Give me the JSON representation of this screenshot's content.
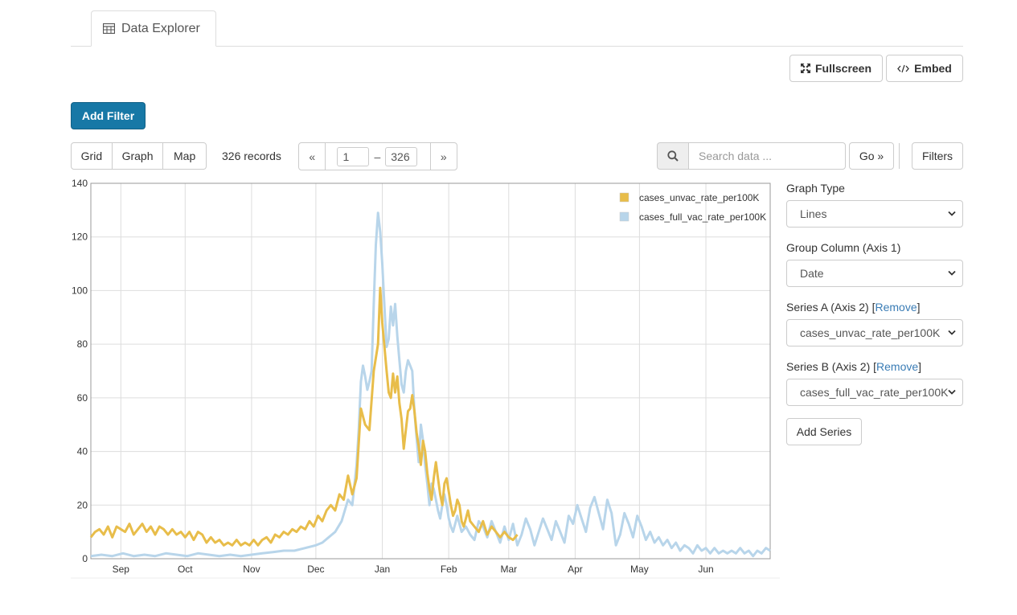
{
  "tab": {
    "label": "Data Explorer",
    "icon": "table-icon"
  },
  "toolbar": {
    "fullscreen_label": "Fullscreen",
    "embed_label": "Embed"
  },
  "filters": {
    "add_filter_label": "Add Filter",
    "filters_label": "Filters"
  },
  "view_switcher": {
    "grid": "Grid",
    "graph": "Graph",
    "map": "Map"
  },
  "records": {
    "count_label": "326 records"
  },
  "pager": {
    "prev": "«",
    "from": "1",
    "dash": "–",
    "to": "326",
    "next": "»"
  },
  "search": {
    "placeholder": "Search data ...",
    "go_label": "Go »"
  },
  "panel": {
    "graph_type_label": "Graph Type",
    "graph_type_value": "Lines",
    "group_column_label": "Group Column (Axis 1)",
    "group_column_value": "Date",
    "series_a_label": "Series A (Axis 2) [",
    "series_a_remove": "Remove",
    "series_a_close": "]",
    "series_a_value": "cases_unvac_rate_per100K",
    "series_b_label": "Series B (Axis 2) [",
    "series_b_remove": "Remove",
    "series_b_close": "]",
    "series_b_value": "cases_full_vac_rate_per100K",
    "add_series_label": "Add Series"
  },
  "chart_data": {
    "type": "line",
    "x_tick_labels": [
      "Sep",
      "Oct",
      "Nov",
      "Dec",
      "Jan",
      "Feb",
      "Mar",
      "Apr",
      "May",
      "Jun"
    ],
    "x_tick_day": [
      17,
      47,
      78,
      108,
      139,
      170,
      198,
      229,
      259,
      290
    ],
    "x_range_day": [
      3,
      320
    ],
    "ylim": [
      0,
      140
    ],
    "y_ticks": [
      0,
      20,
      40,
      60,
      80,
      100,
      120,
      140
    ],
    "grid": true,
    "legend_position": "top-right",
    "series": [
      {
        "name": "cases_unvac_rate_per100K",
        "color": "#e8bd4a",
        "points": [
          [
            3,
            8
          ],
          [
            5,
            10
          ],
          [
            7,
            11
          ],
          [
            9,
            9
          ],
          [
            11,
            12
          ],
          [
            13,
            8
          ],
          [
            15,
            12
          ],
          [
            17,
            11
          ],
          [
            19,
            10
          ],
          [
            21,
            13
          ],
          [
            23,
            9
          ],
          [
            25,
            11
          ],
          [
            27,
            13
          ],
          [
            29,
            10
          ],
          [
            31,
            12
          ],
          [
            33,
            9
          ],
          [
            35,
            12
          ],
          [
            37,
            11
          ],
          [
            39,
            9
          ],
          [
            41,
            11
          ],
          [
            43,
            9
          ],
          [
            45,
            10
          ],
          [
            47,
            8
          ],
          [
            49,
            10
          ],
          [
            51,
            7
          ],
          [
            53,
            10
          ],
          [
            55,
            9
          ],
          [
            57,
            6
          ],
          [
            59,
            8
          ],
          [
            61,
            6
          ],
          [
            63,
            7
          ],
          [
            65,
            5
          ],
          [
            67,
            6
          ],
          [
            69,
            5
          ],
          [
            71,
            7
          ],
          [
            73,
            5
          ],
          [
            75,
            6
          ],
          [
            77,
            5
          ],
          [
            79,
            7
          ],
          [
            81,
            5
          ],
          [
            83,
            7
          ],
          [
            85,
            8
          ],
          [
            87,
            6
          ],
          [
            89,
            9
          ],
          [
            91,
            8
          ],
          [
            93,
            10
          ],
          [
            95,
            9
          ],
          [
            97,
            11
          ],
          [
            99,
            10
          ],
          [
            101,
            12
          ],
          [
            103,
            11
          ],
          [
            105,
            14
          ],
          [
            107,
            12
          ],
          [
            109,
            16
          ],
          [
            111,
            14
          ],
          [
            113,
            18
          ],
          [
            115,
            20
          ],
          [
            117,
            18
          ],
          [
            119,
            24
          ],
          [
            121,
            22
          ],
          [
            123,
            31
          ],
          [
            125,
            24
          ],
          [
            127,
            30
          ],
          [
            129,
            56
          ],
          [
            131,
            50
          ],
          [
            133,
            48
          ],
          [
            135,
            70
          ],
          [
            137,
            80
          ],
          [
            138,
            101
          ],
          [
            139,
            88
          ],
          [
            141,
            70
          ],
          [
            142,
            62
          ],
          [
            143,
            60
          ],
          [
            144,
            69
          ],
          [
            145,
            62
          ],
          [
            146,
            68
          ],
          [
            147,
            58
          ],
          [
            148,
            52
          ],
          [
            149,
            41
          ],
          [
            150,
            48
          ],
          [
            151,
            55
          ],
          [
            152,
            56
          ],
          [
            153,
            61
          ],
          [
            154,
            55
          ],
          [
            155,
            47
          ],
          [
            156,
            42
          ],
          [
            157,
            35
          ],
          [
            158,
            44
          ],
          [
            159,
            40
          ],
          [
            160,
            32
          ],
          [
            161,
            26
          ],
          [
            162,
            22
          ],
          [
            163,
            30
          ],
          [
            164,
            36
          ],
          [
            165,
            30
          ],
          [
            166,
            24
          ],
          [
            167,
            20
          ],
          [
            168,
            28
          ],
          [
            169,
            30
          ],
          [
            170,
            25
          ],
          [
            171,
            20
          ],
          [
            172,
            16
          ],
          [
            173,
            18
          ],
          [
            174,
            22
          ],
          [
            175,
            20
          ],
          [
            176,
            14
          ],
          [
            177,
            12
          ],
          [
            178,
            15
          ],
          [
            179,
            18
          ],
          [
            180,
            14
          ],
          [
            182,
            12
          ],
          [
            184,
            10
          ],
          [
            186,
            14
          ],
          [
            188,
            9
          ],
          [
            190,
            12
          ],
          [
            192,
            10
          ],
          [
            194,
            8
          ],
          [
            196,
            10
          ],
          [
            198,
            8
          ],
          [
            200,
            7
          ],
          [
            202,
            9
          ]
        ]
      },
      {
        "name": "cases_full_vac_rate_per100K",
        "color": "#b8d5ea",
        "points": [
          [
            3,
            1
          ],
          [
            8,
            1.5
          ],
          [
            13,
            1
          ],
          [
            18,
            2
          ],
          [
            23,
            1
          ],
          [
            28,
            1.5
          ],
          [
            33,
            1
          ],
          [
            38,
            2
          ],
          [
            43,
            1.5
          ],
          [
            48,
            1
          ],
          [
            53,
            2
          ],
          [
            58,
            1.5
          ],
          [
            63,
            1
          ],
          [
            68,
            1.5
          ],
          [
            73,
            1
          ],
          [
            78,
            1.5
          ],
          [
            83,
            2
          ],
          [
            88,
            2.5
          ],
          [
            93,
            3
          ],
          [
            98,
            3
          ],
          [
            103,
            4
          ],
          [
            108,
            5
          ],
          [
            111,
            6
          ],
          [
            114,
            8
          ],
          [
            117,
            10
          ],
          [
            120,
            14
          ],
          [
            123,
            22
          ],
          [
            125,
            20
          ],
          [
            127,
            35
          ],
          [
            128,
            48
          ],
          [
            129,
            66
          ],
          [
            130,
            72
          ],
          [
            131,
            68
          ],
          [
            132,
            63
          ],
          [
            133,
            66
          ],
          [
            134,
            70
          ],
          [
            135,
            95
          ],
          [
            136,
            117
          ],
          [
            137,
            129
          ],
          [
            138,
            122
          ],
          [
            139,
            110
          ],
          [
            140,
            94
          ],
          [
            141,
            79
          ],
          [
            142,
            82
          ],
          [
            143,
            94
          ],
          [
            144,
            87
          ],
          [
            145,
            95
          ],
          [
            146,
            83
          ],
          [
            147,
            74
          ],
          [
            148,
            65
          ],
          [
            149,
            62
          ],
          [
            150,
            70
          ],
          [
            151,
            74
          ],
          [
            152,
            72
          ],
          [
            153,
            70
          ],
          [
            154,
            55
          ],
          [
            155,
            45
          ],
          [
            156,
            36
          ],
          [
            157,
            50
          ],
          [
            158,
            44
          ],
          [
            159,
            35
          ],
          [
            160,
            28
          ],
          [
            161,
            20
          ],
          [
            162,
            28
          ],
          [
            163,
            26
          ],
          [
            164,
            22
          ],
          [
            165,
            18
          ],
          [
            166,
            15
          ],
          [
            167,
            20
          ],
          [
            168,
            24
          ],
          [
            169,
            20
          ],
          [
            170,
            15
          ],
          [
            171,
            12
          ],
          [
            172,
            10
          ],
          [
            173,
            13
          ],
          [
            174,
            16
          ],
          [
            175,
            13
          ],
          [
            176,
            10
          ],
          [
            178,
            12
          ],
          [
            180,
            9
          ],
          [
            182,
            7
          ],
          [
            184,
            14
          ],
          [
            186,
            12
          ],
          [
            188,
            8
          ],
          [
            190,
            14
          ],
          [
            192,
            10
          ],
          [
            194,
            6
          ],
          [
            196,
            12
          ],
          [
            198,
            7
          ],
          [
            200,
            13
          ],
          [
            202,
            5
          ],
          [
            204,
            9
          ],
          [
            206,
            15
          ],
          [
            208,
            11
          ],
          [
            210,
            5
          ],
          [
            212,
            10
          ],
          [
            214,
            15
          ],
          [
            216,
            11
          ],
          [
            218,
            7
          ],
          [
            220,
            14
          ],
          [
            222,
            10
          ],
          [
            224,
            6
          ],
          [
            226,
            16
          ],
          [
            228,
            13
          ],
          [
            230,
            20
          ],
          [
            232,
            15
          ],
          [
            234,
            10
          ],
          [
            236,
            19
          ],
          [
            238,
            23
          ],
          [
            240,
            17
          ],
          [
            242,
            11
          ],
          [
            244,
            22
          ],
          [
            246,
            17
          ],
          [
            248,
            5
          ],
          [
            250,
            9
          ],
          [
            252,
            17
          ],
          [
            254,
            13
          ],
          [
            256,
            8
          ],
          [
            258,
            16
          ],
          [
            260,
            12
          ],
          [
            262,
            7
          ],
          [
            264,
            10
          ],
          [
            266,
            6
          ],
          [
            268,
            8
          ],
          [
            270,
            5
          ],
          [
            272,
            7
          ],
          [
            274,
            4
          ],
          [
            276,
            6
          ],
          [
            278,
            3
          ],
          [
            280,
            5
          ],
          [
            282,
            4
          ],
          [
            284,
            2
          ],
          [
            286,
            5
          ],
          [
            288,
            3
          ],
          [
            290,
            4
          ],
          [
            292,
            2
          ],
          [
            294,
            4
          ],
          [
            296,
            2
          ],
          [
            298,
            3
          ],
          [
            300,
            2
          ],
          [
            302,
            3
          ],
          [
            304,
            2
          ],
          [
            306,
            4
          ],
          [
            308,
            2
          ],
          [
            310,
            3
          ],
          [
            312,
            1
          ],
          [
            314,
            3
          ],
          [
            316,
            2
          ],
          [
            318,
            4
          ],
          [
            320,
            3
          ]
        ]
      }
    ]
  }
}
